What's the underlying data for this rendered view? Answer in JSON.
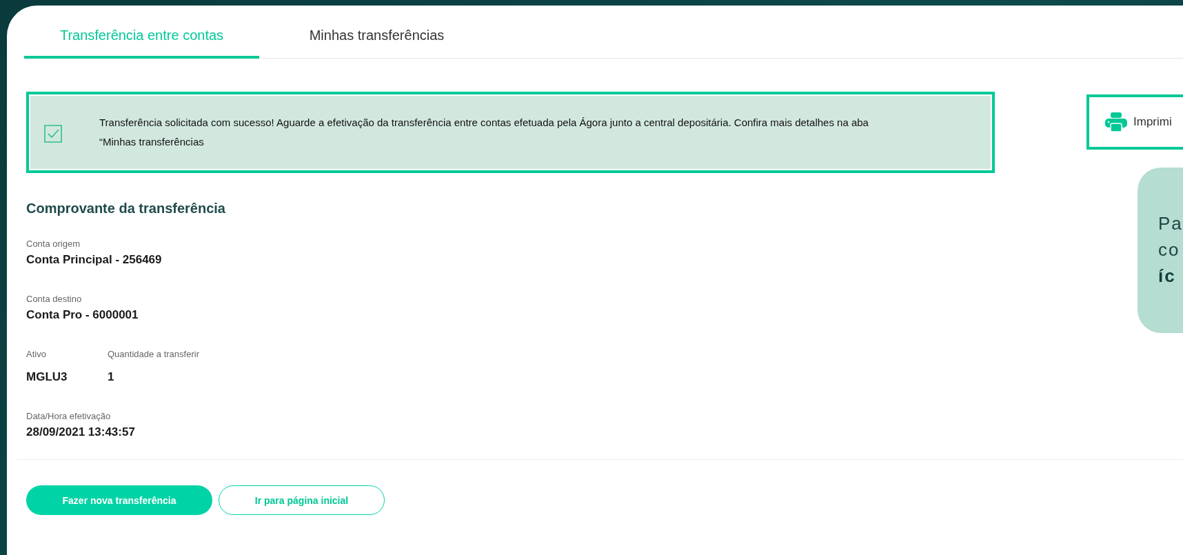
{
  "tabs": [
    {
      "label": "Transferência entre contas",
      "selected": true
    },
    {
      "label": "Minhas transferências",
      "selected": false
    }
  ],
  "alert": {
    "message": "Transferência solicitada com sucesso! Aguarde a efetivação da transferência entre contas efetuada pela Ágora junto a central depositária. Confira mais detalhes na aba “Minhas transferências"
  },
  "print_button": {
    "label": "Imprimi"
  },
  "receipt": {
    "title": "Comprovante da transferência",
    "rows": [
      {
        "fields": [
          {
            "label": "Conta origem",
            "value": "Conta Principal - 256469"
          }
        ]
      },
      {
        "fields": [
          {
            "label": "Conta destino",
            "value": "Conta Pro - 6000001"
          }
        ]
      },
      {
        "fields": [
          {
            "label": "Ativo",
            "value": "MGLU3"
          },
          {
            "label": "Quantidade a transferir",
            "value": "1"
          }
        ]
      },
      {
        "fields": [
          {
            "label": "Data/Hora efetivação",
            "value": "28/09/2021 13:43:57"
          }
        ]
      }
    ]
  },
  "actions": [
    {
      "label": "Fazer nova transferência",
      "kind": "primary"
    },
    {
      "label": "Ir para página inicial",
      "kind": "secondary"
    }
  ],
  "hint_card": {
    "lines": [
      {
        "text": "Pa",
        "bold": false
      },
      {
        "text": "co",
        "bold": false
      },
      {
        "text": "íc",
        "bold": true
      }
    ]
  }
}
